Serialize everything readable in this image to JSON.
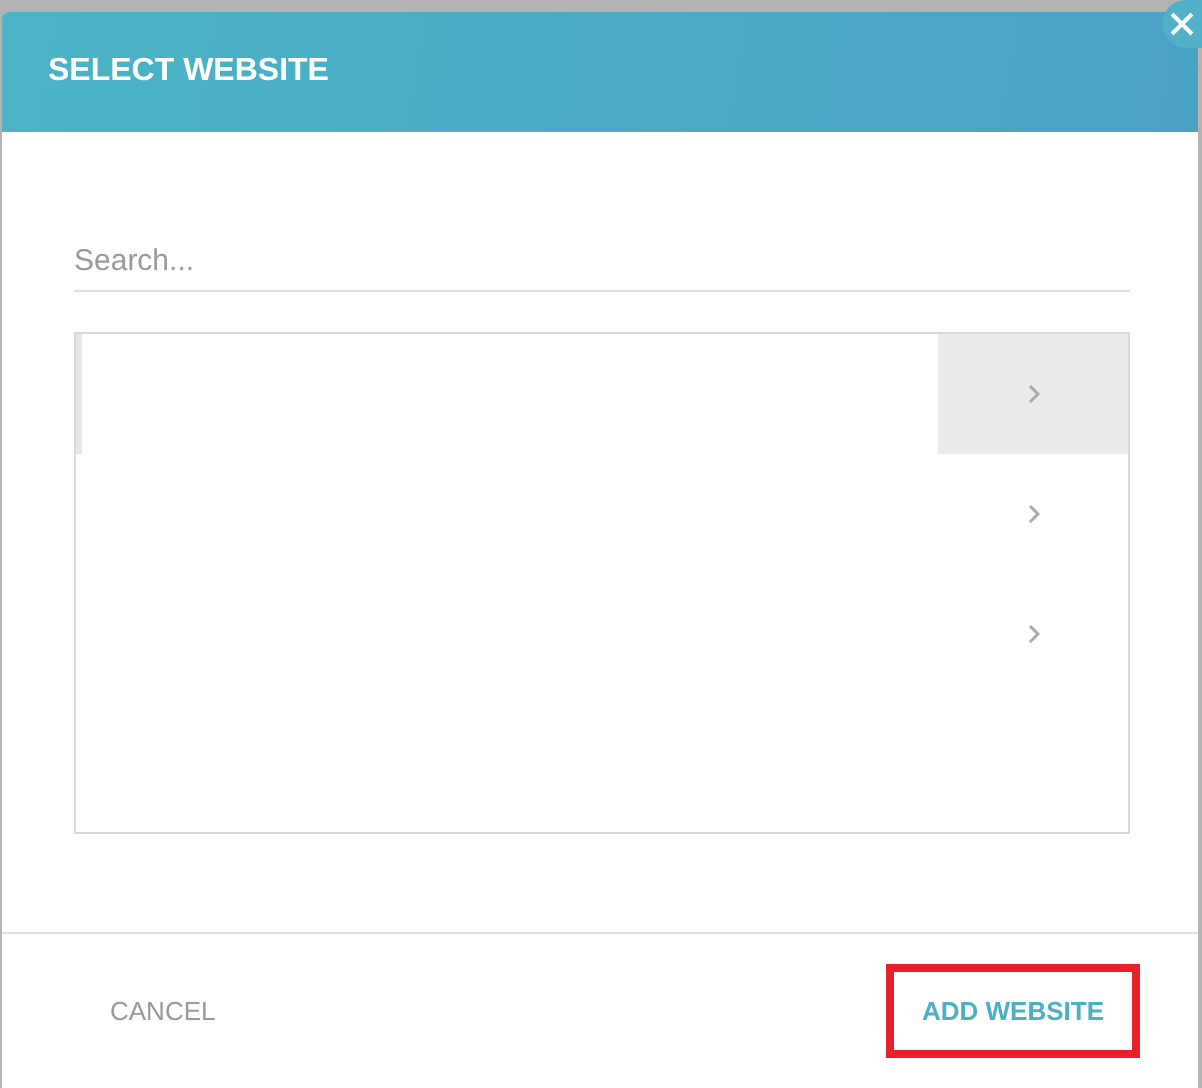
{
  "dialog": {
    "title": "SELECT WEBSITE"
  },
  "search": {
    "placeholder": "Search..."
  },
  "list": {
    "rows": [
      {
        "selected": true
      },
      {
        "selected": false
      },
      {
        "selected": false
      }
    ]
  },
  "buttons": [
    {
      "label": "CANCEL",
      "kind": "secondary",
      "highlighted": false
    },
    {
      "label": "ADD WEBSITE",
      "kind": "primary",
      "highlighted": true
    }
  ]
}
